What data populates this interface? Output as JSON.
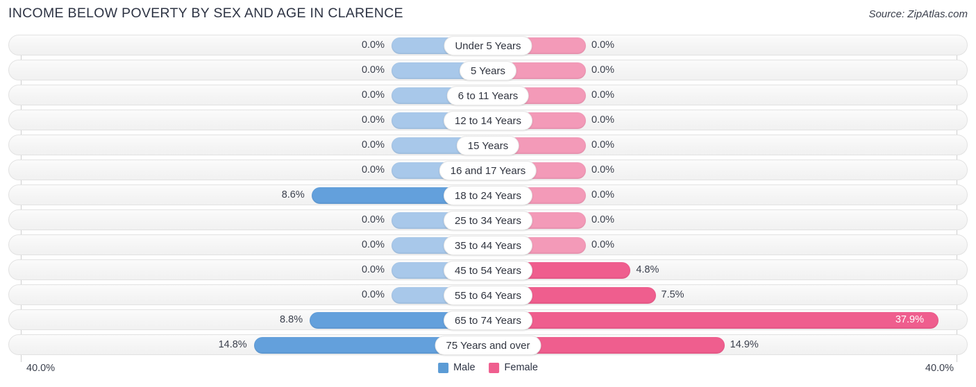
{
  "header": {
    "title": "INCOME BELOW POVERTY BY SEX AND AGE IN CLARENCE",
    "source": "Source: ZipAtlas.com"
  },
  "legend": {
    "male_label": "Male",
    "female_label": "Female",
    "male_color": "#5b9bd5",
    "female_color": "#ef5e8e"
  },
  "axis": {
    "left_tick": "40.0%",
    "right_tick": "40.0%"
  },
  "chart_data": {
    "type": "bar",
    "title": "INCOME BELOW POVERTY BY SEX AND AGE IN CLARENCE",
    "xlabel": "",
    "ylabel": "",
    "orientation": "horizontal-diverging",
    "xlim": [
      -40.0,
      40.0
    ],
    "grid": false,
    "legend_position": "bottom-center",
    "categories": [
      "Under 5 Years",
      "5 Years",
      "6 to 11 Years",
      "12 to 14 Years",
      "15 Years",
      "16 and 17 Years",
      "18 to 24 Years",
      "25 to 34 Years",
      "35 to 44 Years",
      "45 to 54 Years",
      "55 to 64 Years",
      "65 to 74 Years",
      "75 Years and over"
    ],
    "series": [
      {
        "name": "Male",
        "values": [
          0.0,
          0.0,
          0.0,
          0.0,
          0.0,
          0.0,
          8.6,
          0.0,
          0.0,
          0.0,
          0.0,
          8.8,
          14.8
        ],
        "labels": [
          "0.0%",
          "0.0%",
          "0.0%",
          "0.0%",
          "0.0%",
          "0.0%",
          "8.6%",
          "0.0%",
          "0.0%",
          "0.0%",
          "0.0%",
          "8.8%",
          "14.8%"
        ]
      },
      {
        "name": "Female",
        "values": [
          0.0,
          0.0,
          0.0,
          0.0,
          0.0,
          0.0,
          0.0,
          0.0,
          0.0,
          4.8,
          7.5,
          37.9,
          14.9
        ],
        "labels": [
          "0.0%",
          "0.0%",
          "0.0%",
          "0.0%",
          "0.0%",
          "0.0%",
          "0.0%",
          "0.0%",
          "0.0%",
          "4.8%",
          "7.5%",
          "37.9%",
          "14.9%"
        ]
      }
    ]
  }
}
